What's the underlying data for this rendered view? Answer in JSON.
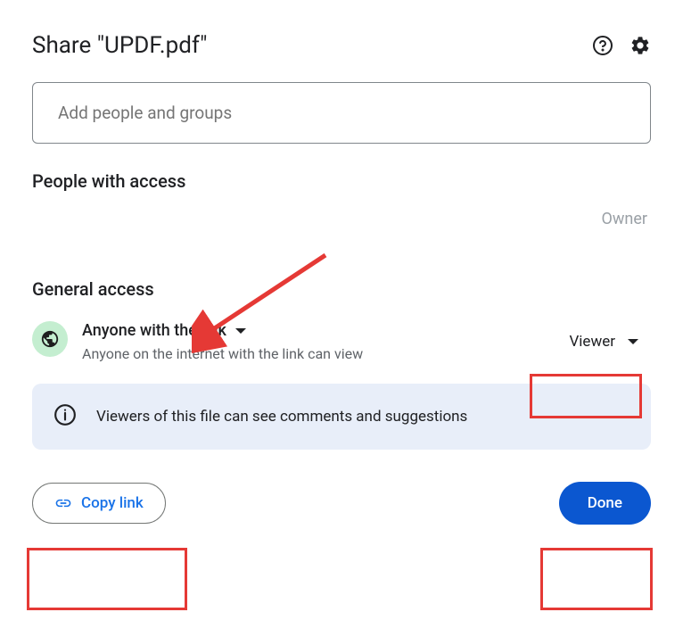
{
  "header": {
    "title": "Share \"UPDF.pdf\""
  },
  "input": {
    "placeholder": "Add people and groups"
  },
  "sections": {
    "people_heading": "People with access",
    "owner_label": "Owner",
    "general_heading": "General access"
  },
  "access": {
    "scope_label": "Anyone with the link",
    "scope_desc": "Anyone on the internet with the link can view",
    "role_label": "Viewer"
  },
  "banner": {
    "text": "Viewers of this file can see comments and suggestions"
  },
  "footer": {
    "copy_link": "Copy link",
    "done": "Done"
  }
}
